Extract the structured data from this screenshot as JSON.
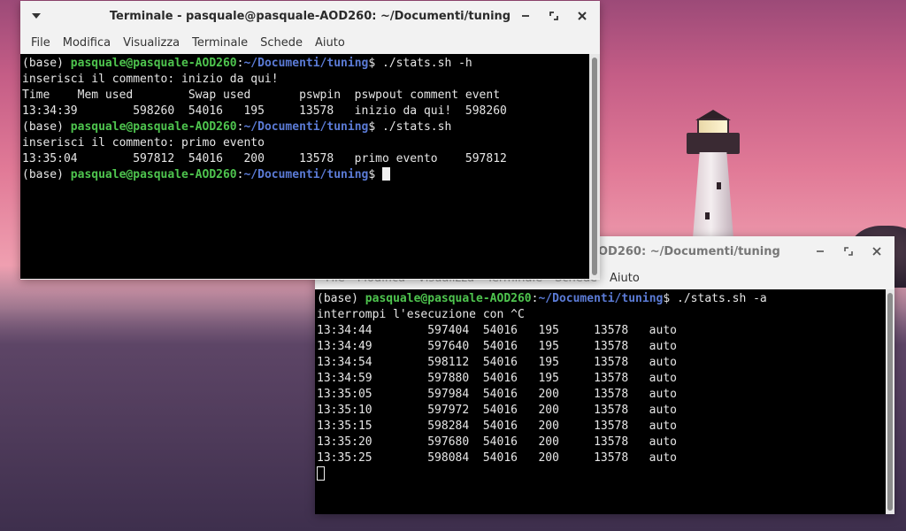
{
  "window1": {
    "title": "Terminale - pasquale@pasquale-AOD260: ~/Documenti/tuning",
    "menu": [
      "File",
      "Modifica",
      "Visualizza",
      "Terminale",
      "Schede",
      "Aiuto"
    ],
    "lines": [
      {
        "prompt": {
          "base": "(base) ",
          "user": "pasquale@pasquale-AOD260",
          "colon": ":",
          "path": "~/Documenti/tuning",
          "end": "$ "
        },
        "text": "./stats.sh -h"
      },
      {
        "text": "inserisci il commento: inizio da qui!"
      },
      {
        "text": "Time    Mem used        Swap used       pswpin  pswpout comment event"
      },
      {
        "text": "13:34:39        598260  54016   195     13578   inizio da qui!  598260"
      },
      {
        "prompt": {
          "base": "(base) ",
          "user": "pasquale@pasquale-AOD260",
          "colon": ":",
          "path": "~/Documenti/tuning",
          "end": "$ "
        },
        "text": "./stats.sh"
      },
      {
        "text": "inserisci il commento: primo evento"
      },
      {
        "text": "13:35:04        597812  54016   200     13578   primo evento    597812"
      },
      {
        "prompt": {
          "base": "(base) ",
          "user": "pasquale@pasquale-AOD260",
          "colon": ":",
          "path": "~/Documenti/tuning",
          "end": "$ "
        },
        "text": "",
        "cursor": true
      }
    ]
  },
  "window2": {
    "title_visible": "OD260: ~/Documenti/tuning",
    "menu": [
      "File",
      "Modifica",
      "Visualizza",
      "Terminale",
      "Schede",
      "Aiuto"
    ],
    "lines": [
      {
        "prompt": {
          "base": "(base) ",
          "user": "pasquale@pasquale-AOD260",
          "colon": ":",
          "path": "~/Documenti/tuning",
          "end": "$ "
        },
        "text": "./stats.sh -a"
      },
      {
        "text": "interrompi l'esecuzione con ^C"
      },
      {
        "text": "13:34:44        597404  54016   195     13578   auto"
      },
      {
        "text": "13:34:49        597640  54016   195     13578   auto"
      },
      {
        "text": "13:34:54        598112  54016   195     13578   auto"
      },
      {
        "text": "13:34:59        597880  54016   195     13578   auto"
      },
      {
        "text": "13:35:05        597984  54016   200     13578   auto"
      },
      {
        "text": "13:35:10        597972  54016   200     13578   auto"
      },
      {
        "text": "13:35:15        598284  54016   200     13578   auto"
      },
      {
        "text": "13:35:20        597680  54016   200     13578   auto"
      },
      {
        "text": "13:35:25        598084  54016   200     13578   auto"
      },
      {
        "text": "",
        "hollow_cursor": true
      }
    ]
  },
  "icons": {
    "window_menu": "chevron-down-icon",
    "minimize": "minimize-icon",
    "maximize": "maximize-icon",
    "close": "close-icon"
  }
}
